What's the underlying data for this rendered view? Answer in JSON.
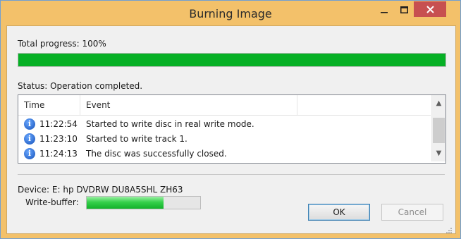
{
  "window": {
    "title": "Burning Image",
    "controls": {
      "minimize": "minimize-icon",
      "maximize": "maximize-icon",
      "close": "close-icon"
    }
  },
  "progress": {
    "label": "Total progress: 100%",
    "value_percent": 100,
    "color": "#06b025"
  },
  "status": {
    "label": "Status: Operation completed."
  },
  "log": {
    "columns": [
      "Time",
      "Event"
    ],
    "rows": [
      {
        "icon": "info-icon",
        "time": "11:22:54",
        "event": "Started to write disc in real write mode."
      },
      {
        "icon": "info-icon",
        "time": "11:23:10",
        "event": "Started to write track 1."
      },
      {
        "icon": "info-icon",
        "time": "11:24:13",
        "event": "The disc was successfully closed."
      }
    ]
  },
  "device": {
    "label": "Device: E: hp DVDRW  DU8A5SHL ZH63"
  },
  "write_buffer": {
    "label": "Write-buffer:",
    "fill_percent": 68
  },
  "buttons": {
    "ok": "OK",
    "cancel": "Cancel"
  },
  "colors": {
    "titlebar": "#f3c16a",
    "close_button": "#c75050",
    "accent_border": "#3c7fb1"
  }
}
